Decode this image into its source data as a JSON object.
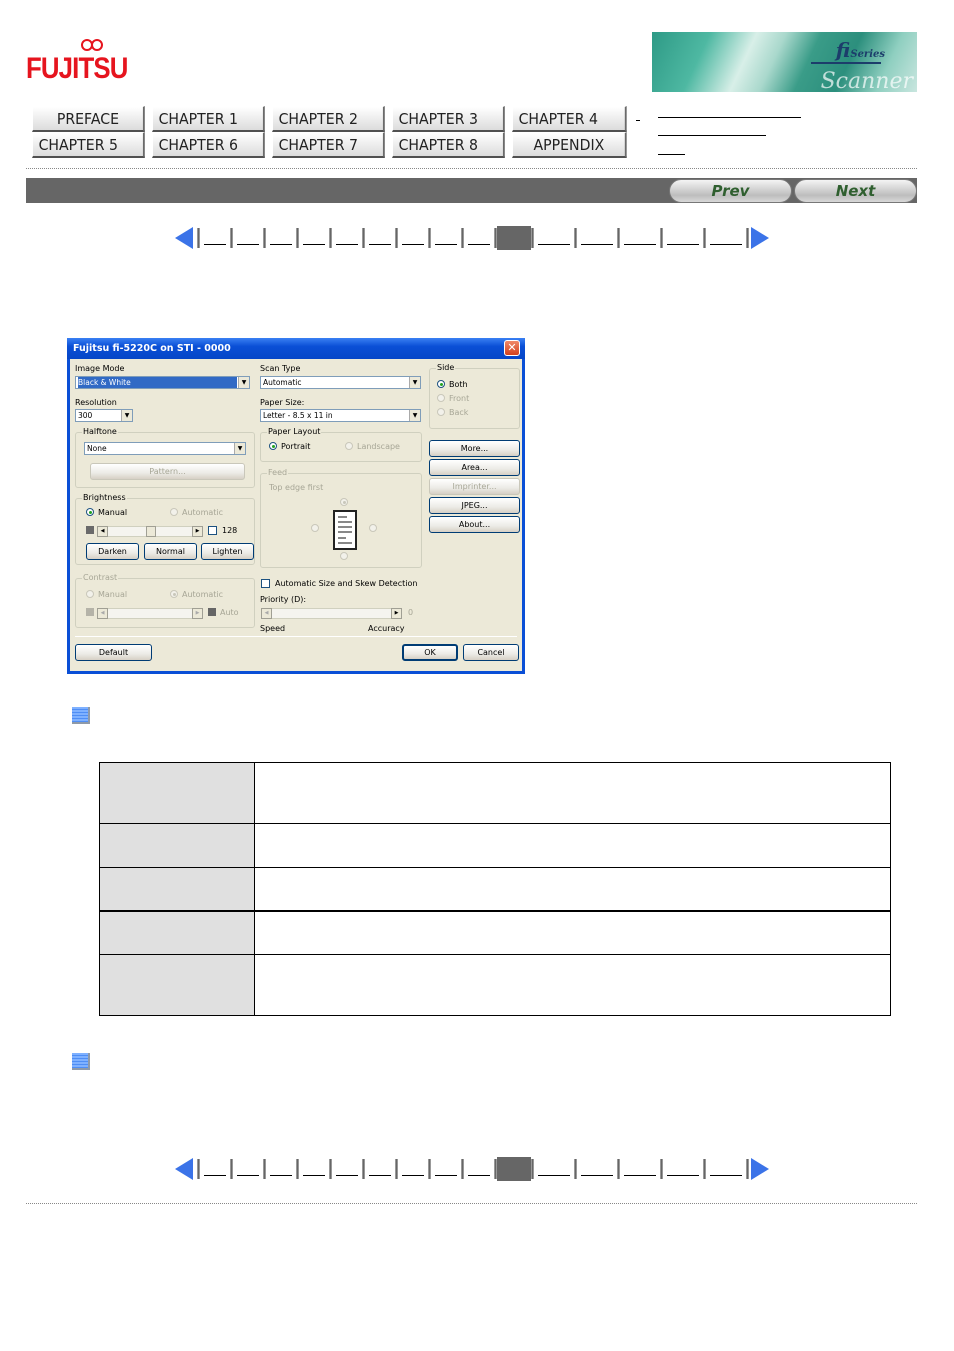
{
  "header": {
    "logo_text": "FUJITSU",
    "banner": {
      "series_label": "fi Series",
      "series_small": "Series",
      "series_main": "fi",
      "scanner_text": "Scanner"
    }
  },
  "chapter_nav": {
    "items": [
      {
        "label": "PREFACE"
      },
      {
        "label": "CHAPTER 1"
      },
      {
        "label": "CHAPTER 2"
      },
      {
        "label": "CHAPTER 3"
      },
      {
        "label": "CHAPTER 4"
      },
      {
        "label": "CHAPTER 5"
      },
      {
        "label": "CHAPTER 6"
      },
      {
        "label": "CHAPTER 7"
      },
      {
        "label": "CHAPTER 8"
      },
      {
        "label": "APPENDIX"
      }
    ]
  },
  "title_bar": {
    "prev_label": "Prev",
    "next_label": "Next"
  },
  "page_nav": {
    "page_count": 15,
    "current_index": 10
  },
  "dialog": {
    "title": "Fujitsu fi-5220C   on STI - 0000",
    "close_glyph": "✕",
    "image_mode": {
      "label": "Image Mode",
      "value": "Black & White"
    },
    "resolution": {
      "label": "Resolution",
      "value": "300"
    },
    "halftone": {
      "label": "Halftone",
      "value": "None",
      "pattern_button": "Pattern..."
    },
    "brightness": {
      "label": "Brightness",
      "manual": "Manual",
      "automatic": "Automatic",
      "value": "128",
      "slider_level": 0.5,
      "darken": "Darken",
      "normal": "Normal",
      "lighten": "Lighten"
    },
    "contrast": {
      "label": "Contrast",
      "manual": "Manual",
      "automatic": "Automatic",
      "auto": "Auto"
    },
    "scan_type": {
      "label": "Scan Type",
      "value": "Automatic"
    },
    "paper_size": {
      "label": "Paper Size:",
      "value": "Letter - 8.5 x 11 in"
    },
    "paper_layout": {
      "label": "Paper Layout",
      "portrait": "Portrait",
      "landscape": "Landscape"
    },
    "feed": {
      "label": "Feed",
      "hint": "Top edge first"
    },
    "auto_detect": {
      "label": "Automatic Size and Skew Detection",
      "checked": false
    },
    "priority": {
      "label": "Priority (D):",
      "value": "0",
      "min_label": "Speed",
      "max_label": "Accuracy"
    },
    "side": {
      "label": "Side",
      "both": "Both",
      "front": "Front",
      "back": "Back"
    },
    "buttons": {
      "more": "More...",
      "area": "Area...",
      "imprinter": "Imprinter...",
      "jpeg": "JPEG...",
      "about": "About...",
      "default": "Default",
      "ok": "OK",
      "cancel": "Cancel"
    }
  },
  "table": {
    "rows": [
      {
        "header": "",
        "body": ""
      },
      {
        "header": "",
        "body": ""
      },
      {
        "header": "",
        "body": ""
      },
      {
        "header": "",
        "body": ""
      },
      {
        "header": "",
        "body": ""
      }
    ]
  }
}
